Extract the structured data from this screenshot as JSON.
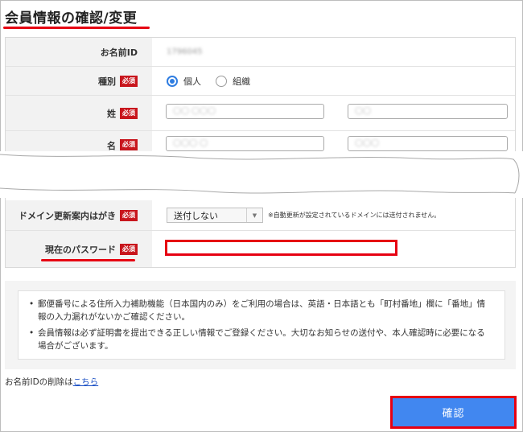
{
  "page": {
    "title": "会員情報の確認/変更"
  },
  "form": {
    "member_id": {
      "label": "お名前ID",
      "value": "1796045"
    },
    "type": {
      "label": "種別",
      "required": "必須",
      "options": [
        {
          "label": "個人",
          "selected": true
        },
        {
          "label": "組織",
          "selected": false
        }
      ]
    },
    "last_name": {
      "label": "姓",
      "required": "必須",
      "value_left": "◯◯ ◯◯◯",
      "value_right": "◯◯"
    },
    "first_name": {
      "label": "名",
      "required": "必須",
      "value_left": "◯◯◯ ◯",
      "value_right": "◯◯◯"
    },
    "domain_mail": {
      "label": "ドメイン更新案内はがき",
      "required": "必須",
      "selected": "送付しない",
      "note": "※自動更新が設定されているドメインには送付されません。"
    },
    "password": {
      "label": "現在のパスワード",
      "required": "必須",
      "value": ""
    }
  },
  "notice": {
    "items": [
      "郵便番号による住所入力補助機能（日本国内のみ）をご利用の場合は、英語・日本語とも「町村番地」欄に「番地」情報の入力漏れがないかご確認ください。",
      "会員情報は必ず証明書を提出できる正しい情報でご登録ください。大切なお知らせの送付や、本人確認時に必要になる場合がございます。"
    ]
  },
  "delete_id": {
    "prefix": "お名前IDの削除は",
    "link": "こちら"
  },
  "confirm_button": "確認",
  "colors": {
    "accent_red": "#e60012",
    "button_blue": "#4187f0",
    "radio_blue": "#2f7de1"
  }
}
